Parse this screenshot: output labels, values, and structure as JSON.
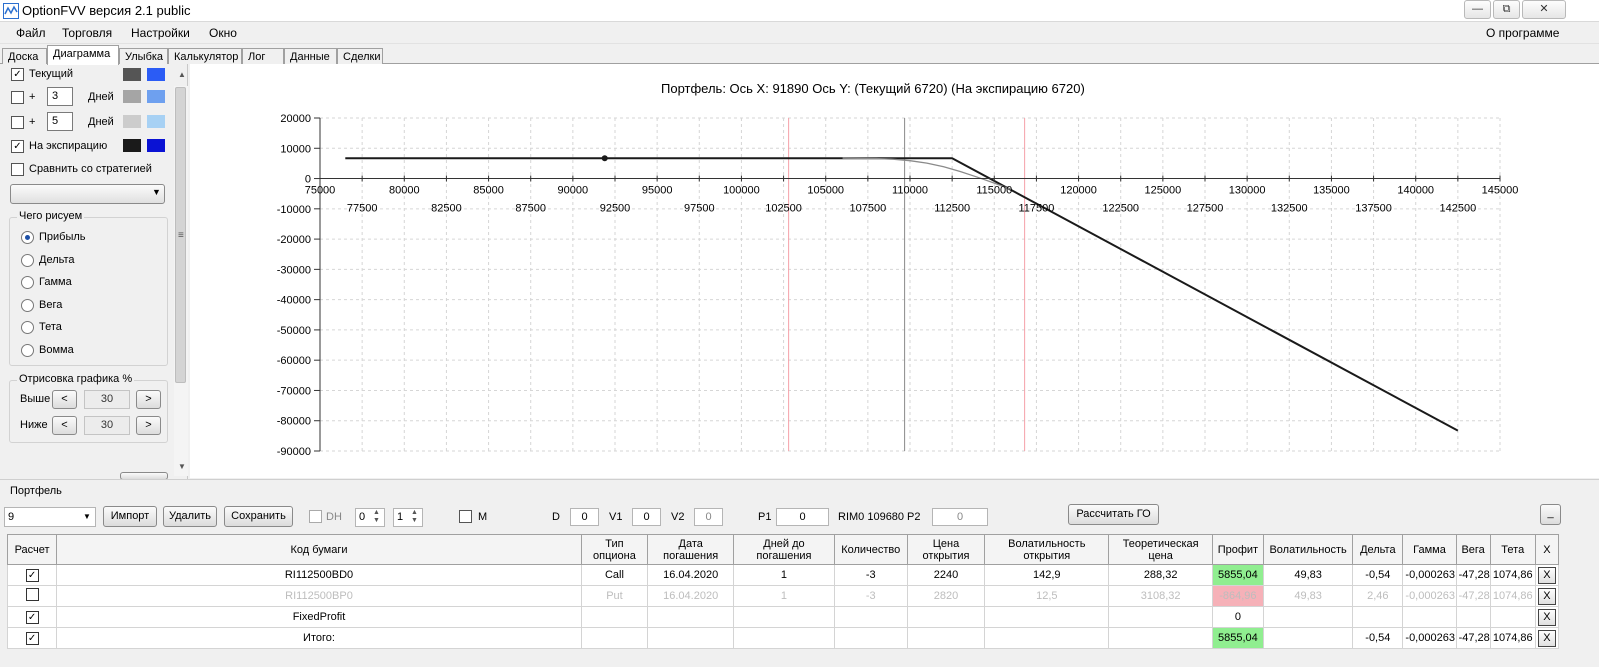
{
  "window": {
    "title": "OptionFVV версия 2.1 public",
    "minimize": "—",
    "restore": "⧉",
    "close": "✕"
  },
  "menu": {
    "items": [
      "Файл",
      "Торговля",
      "Настройки",
      "Окно"
    ],
    "about": "О программе"
  },
  "tabs": [
    "Доска",
    "Диаграмма",
    "Улыбка",
    "Калькулятор",
    "Лог",
    "Данные",
    "Сделки"
  ],
  "active_tab": "Диаграмма",
  "left_panel": {
    "current": {
      "label": "Текущий",
      "checked": true,
      "colors": [
        "#555555",
        "#2b5cf5"
      ]
    },
    "plus3": {
      "plus": "+",
      "value": "3",
      "unit": "Дней",
      "checked": false,
      "colors": [
        "#a5a5a5",
        "#6ea0ef"
      ]
    },
    "plus5": {
      "plus": "+",
      "value": "5",
      "unit": "Дней",
      "checked": false,
      "colors": [
        "#cccccc",
        "#a7d1f4"
      ]
    },
    "expiry": {
      "label": "На экспирацию",
      "checked": true,
      "colors": [
        "#1a1a1a",
        "#0a12d4"
      ]
    },
    "compare": {
      "label": "Сравнить со стратегией",
      "checked": false
    },
    "dropdown_value": "",
    "draw_group": {
      "title": "Чего рисуем",
      "options": [
        "Прибыль",
        "Дельта",
        "Гамма",
        "Вега",
        "Тета",
        "Вомма"
      ],
      "selected": "Прибыль"
    },
    "percent_group": {
      "title": "Отрисовка графика %",
      "above": {
        "label": "Выше",
        "dec": "<",
        "value": "30",
        "inc": ">"
      },
      "below": {
        "label": "Ниже",
        "dec": "<",
        "value": "30",
        "inc": ">"
      }
    }
  },
  "chart_header": "Портфель: Ось X: 91890 Ось Y:  (Текущий 6720)  (На экспирацию 6720)",
  "chart_data": {
    "type": "line",
    "title": "Портфель: Ось X: 91890 Ось Y:  (Текущий 6720)  (На экспирацию 6720)",
    "xlim": [
      75000,
      145000
    ],
    "ylim": [
      -90000,
      20000
    ],
    "x_ticks_upper": [
      75000,
      80000,
      85000,
      90000,
      95000,
      100000,
      105000,
      110000,
      115000,
      120000,
      125000,
      130000,
      135000,
      140000,
      145000
    ],
    "x_ticks_lower": [
      77500,
      82500,
      87500,
      92500,
      97500,
      102500,
      107500,
      112500,
      117500,
      122500,
      127500,
      132500,
      137500,
      142500
    ],
    "y_ticks": [
      20000,
      10000,
      0,
      -10000,
      -20000,
      -30000,
      -40000,
      -50000,
      -60000,
      -70000,
      -80000,
      -90000
    ],
    "grid": true,
    "vertical_lines": [
      {
        "x": 102800,
        "color": "#f4a0a8"
      },
      {
        "x": 109680,
        "color": "#8a8a8a"
      },
      {
        "x": 116800,
        "color": "#f4a0a8"
      }
    ],
    "marker": {
      "x": 91890,
      "y": 6720
    },
    "series": [
      {
        "color": "#1a1a1a",
        "x": [
          76500,
          112500,
          142500
        ],
        "y": [
          6720,
          6720,
          -83280
        ]
      },
      {
        "color": "#8a8a8a",
        "x": [
          106000,
          108000,
          109000,
          110000,
          111000,
          112000,
          113000,
          114000,
          115000,
          116000
        ],
        "y": [
          6720,
          6630,
          6380,
          5900,
          5100,
          3900,
          2300,
          450,
          -1500,
          -3600
        ]
      }
    ]
  },
  "portfolio": {
    "group_title": "Портфель",
    "selector_value": "9",
    "buttons": {
      "import": "Импорт",
      "delete": "Удалить",
      "save": "Сохранить",
      "calc_go": "Рассчитать ГО",
      "minimize": "_"
    },
    "dh": {
      "label": "DH",
      "spin1": "0",
      "spin2": "1"
    },
    "m_label": "M",
    "d": {
      "label": "D",
      "value": "0"
    },
    "v1": {
      "label": "V1",
      "value": "0"
    },
    "v2": {
      "label": "V2",
      "value": "0"
    },
    "p1": {
      "label": "P1",
      "value": "0"
    },
    "rim": "RIM0 109680",
    "p2": {
      "label": "P2",
      "value": "0"
    }
  },
  "grid": {
    "headers": [
      "Расчет",
      "Код бумаги",
      "Тип опциона",
      "Дата погашения",
      "Дней до погашения",
      "Количество",
      "Цена открытия",
      "Волатильность открытия",
      "Теоретическая цена",
      "Профит",
      "Волатильность",
      "Дельта",
      "Гамма",
      "Вега",
      "Тета",
      "X"
    ],
    "rows": [
      {
        "checked": true,
        "disabled": false,
        "cells": [
          "RI112500BD0",
          "Call",
          "16.04.2020",
          "1",
          "-3",
          "2240",
          "142,9",
          "288,32",
          "5855,04",
          "49,83",
          "-0,54",
          "-0,000263",
          "-47,28",
          "1074,86"
        ],
        "profit_style": "green",
        "x": "X"
      },
      {
        "checked": false,
        "disabled": true,
        "cells": [
          "RI112500BP0",
          "Put",
          "16.04.2020",
          "1",
          "-3",
          "2820",
          "12,5",
          "3108,32",
          "-864,96",
          "49,83",
          "2,46",
          "-0,000263",
          "-47,28",
          "1074,86"
        ],
        "profit_style": "pink",
        "x": "X"
      },
      {
        "checked": true,
        "disabled": false,
        "cells": [
          "FixedProfit",
          "",
          "",
          "",
          "",
          "",
          "",
          "",
          "0",
          "",
          "",
          "",
          "",
          ""
        ],
        "profit_style": "",
        "x": "X"
      },
      {
        "checked": true,
        "disabled": false,
        "cells": [
          "Итого:",
          "",
          "",
          "",
          "",
          "",
          "",
          "",
          "5855,04",
          "",
          "-0,54",
          "-0,000263",
          "-47,28",
          "1074,86"
        ],
        "profit_style": "green",
        "x": "X"
      }
    ]
  }
}
